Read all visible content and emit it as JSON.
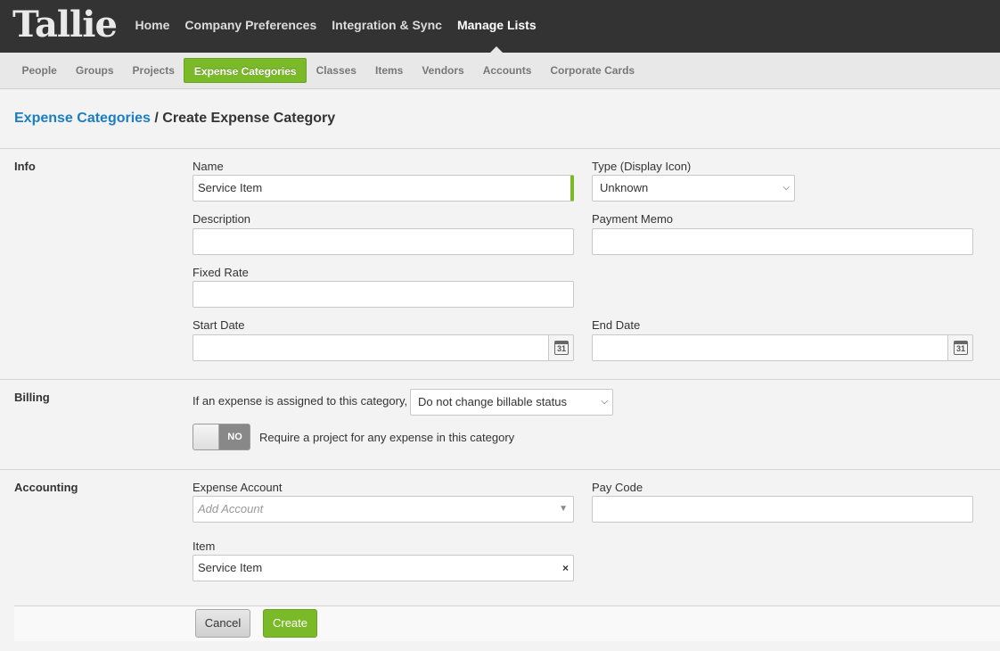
{
  "app": {
    "logo_text": "Tallie"
  },
  "topnav": [
    {
      "label": "Home"
    },
    {
      "label": "Company Preferences"
    },
    {
      "label": "Integration & Sync"
    },
    {
      "label": "Manage Lists",
      "active": true
    }
  ],
  "subnav": [
    {
      "label": "People"
    },
    {
      "label": "Groups"
    },
    {
      "label": "Projects"
    },
    {
      "label": "Expense Categories",
      "active": true
    },
    {
      "label": "Classes"
    },
    {
      "label": "Items"
    },
    {
      "label": "Vendors"
    },
    {
      "label": "Accounts"
    },
    {
      "label": "Corporate Cards"
    }
  ],
  "breadcrumb": {
    "link": "Expense Categories",
    "current": " / Create Expense Category"
  },
  "info": {
    "section": "Info",
    "name_label": "Name",
    "name_value": "Service Item",
    "type_label": "Type (Display Icon)",
    "type_value": "Unknown",
    "description_label": "Description",
    "description_value": "",
    "payment_memo_label": "Payment Memo",
    "payment_memo_value": "",
    "fixed_rate_label": "Fixed Rate",
    "fixed_rate_value": "",
    "start_date_label": "Start Date",
    "start_date_value": "",
    "end_date_label": "End Date",
    "end_date_value": "",
    "calendar_day": "31"
  },
  "billing": {
    "section": "Billing",
    "assigned_text": "If an expense is assigned to this category,",
    "billable_value": "Do not change billable status",
    "toggle_label": "NO",
    "require_project_text": "Require a project for any expense in this category"
  },
  "accounting": {
    "section": "Accounting",
    "expense_account_label": "Expense Account",
    "expense_account_placeholder": "Add Account",
    "pay_code_label": "Pay Code",
    "pay_code_value": "",
    "item_label": "Item",
    "item_value": "Service Item",
    "clear_symbol": "×"
  },
  "footer": {
    "cancel_label": "Cancel",
    "create_label": "Create"
  }
}
